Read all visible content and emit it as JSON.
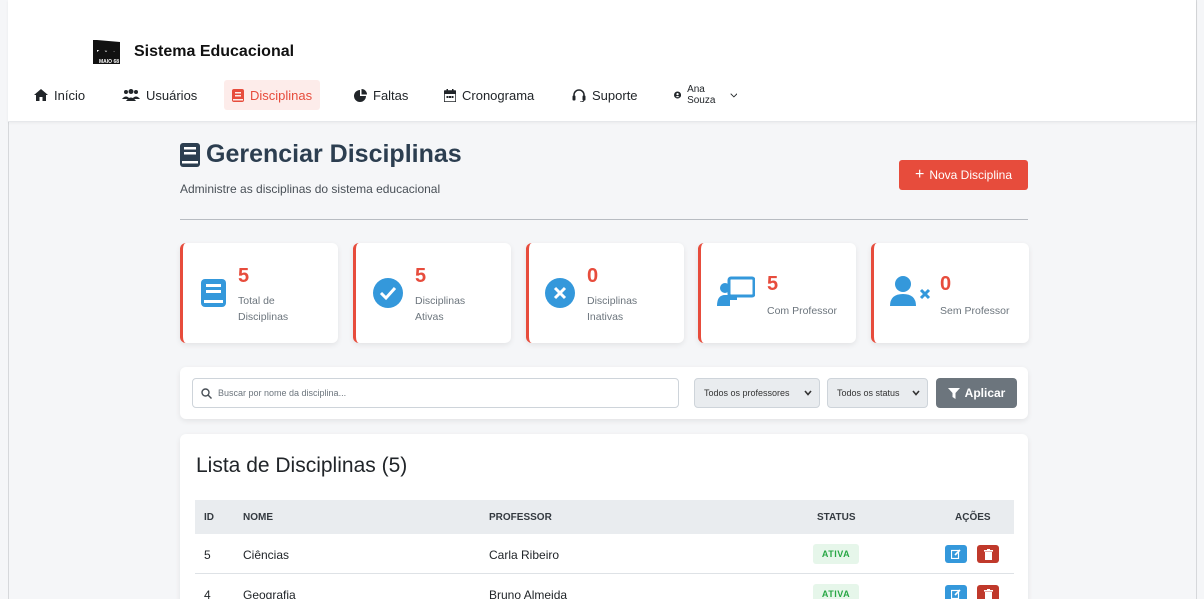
{
  "app": {
    "title": "Sistema Educacional",
    "logo_text": "MAIO 68"
  },
  "nav": [
    {
      "label": "Início",
      "icon": "home-icon"
    },
    {
      "label": "Usuários",
      "icon": "users-icon"
    },
    {
      "label": "Disciplinas",
      "icon": "book-icon",
      "active": true
    },
    {
      "label": "Faltas",
      "icon": "pie-chart-icon"
    },
    {
      "label": "Cronograma",
      "icon": "calendar-icon"
    },
    {
      "label": "Suporte",
      "icon": "headset-icon"
    }
  ],
  "user": {
    "name": "Ana Souza"
  },
  "page": {
    "title": "Gerenciar Disciplinas",
    "subtitle": "Administre as disciplinas do sistema educacional",
    "new_button": "Nova Disciplina"
  },
  "stats": [
    {
      "value": "5",
      "label_line1": "Total de",
      "label_line2": "Disciplinas",
      "icon": "book-icon"
    },
    {
      "value": "5",
      "label_line1": "Disciplinas",
      "label_line2": "Ativas",
      "icon": "check-circle-icon"
    },
    {
      "value": "0",
      "label_line1": "Disciplinas",
      "label_line2": "Inativas",
      "icon": "x-circle-icon"
    },
    {
      "value": "5",
      "label_line1": "Com Professor",
      "label_line2": "",
      "icon": "teacher-icon"
    },
    {
      "value": "0",
      "label_line1": "Sem Professor",
      "label_line2": "",
      "icon": "user-x-icon"
    }
  ],
  "filters": {
    "search_placeholder": "Buscar por nome da disciplina...",
    "professor_select": "Todos os professores",
    "status_select": "Todos os status",
    "apply_button": "Aplicar"
  },
  "list": {
    "title": "Lista de Disciplinas (5)",
    "columns": [
      "ID",
      "NOME",
      "PROFESSOR",
      "STATUS",
      "AÇÕES"
    ],
    "rows": [
      {
        "id": "5",
        "nome": "Ciências",
        "professor": "Carla Ribeiro",
        "status": "ATIVA"
      },
      {
        "id": "4",
        "nome": "Geografia",
        "professor": "Bruno Almeida",
        "status": "ATIVA"
      }
    ]
  },
  "colors": {
    "accent": "#e74c3c",
    "info": "#3498db",
    "success": "#28a745",
    "heading": "#2c3e50"
  }
}
